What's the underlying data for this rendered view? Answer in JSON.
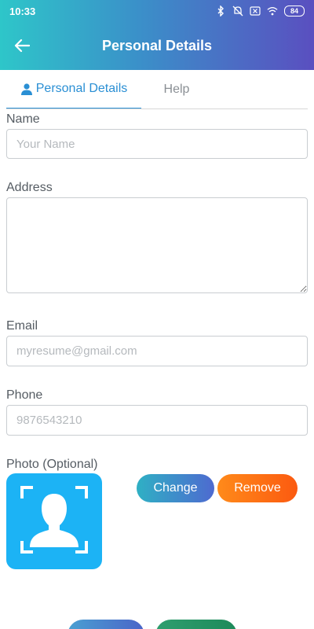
{
  "status_bar": {
    "time": "10:33",
    "battery": "84"
  },
  "header": {
    "title": "Personal Details"
  },
  "tabs": [
    {
      "label": "Personal Details",
      "active": true
    },
    {
      "label": "Help",
      "active": false
    }
  ],
  "form": {
    "name": {
      "label": "Name",
      "placeholder": "Your Name",
      "value": ""
    },
    "address": {
      "label": "Address",
      "value": ""
    },
    "email": {
      "label": "Email",
      "placeholder": "myresume@gmail.com",
      "value": ""
    },
    "phone": {
      "label": "Phone",
      "placeholder": "9876543210",
      "value": ""
    },
    "photo": {
      "label": "Photo (Optional)",
      "change_label": "Change",
      "remove_label": "Remove"
    }
  },
  "colors": {
    "accent": "#2a8fd4",
    "photo_bg": "#1cb3f5",
    "change_btn": "#3f8ccb",
    "remove_btn": "#fb6f14"
  }
}
